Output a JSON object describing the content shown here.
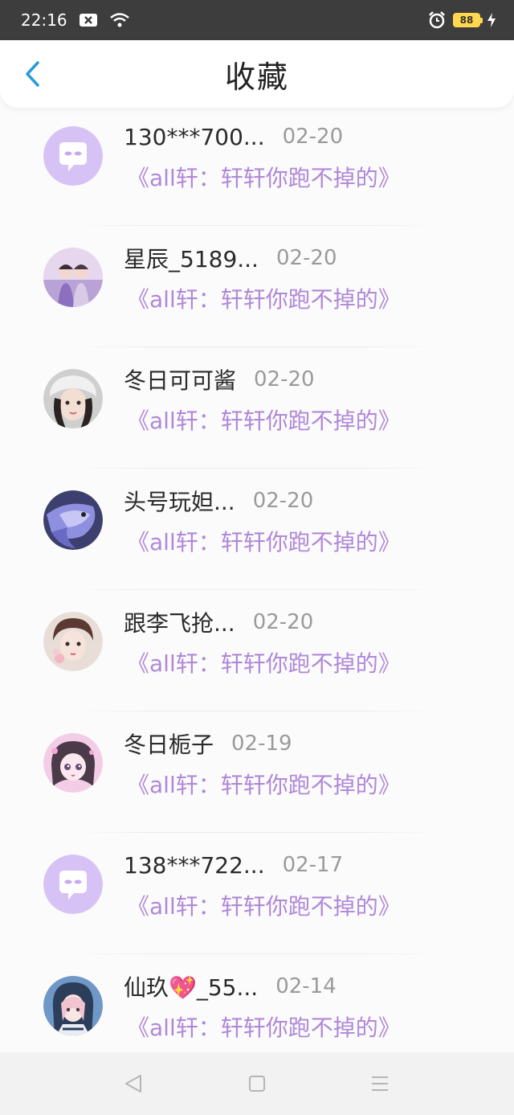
{
  "status_bar": {
    "time": "22:16",
    "battery": "88",
    "icons": [
      "notification-x-icon",
      "wifi-icon",
      "alarm-icon",
      "battery-icon",
      "charging-icon"
    ]
  },
  "header": {
    "title": "收藏",
    "back_icon": "chevron-left-icon",
    "accent_color": "#2a9bd8"
  },
  "story_color": "#b088d8",
  "items": [
    {
      "name": "130***700...",
      "date": "02-20",
      "story": "《all轩：轩轩你跑不掉的》",
      "avatar": "default-chat-avatar"
    },
    {
      "name": "星辰_5189...",
      "date": "02-20",
      "story": "《all轩：轩轩你跑不掉的》",
      "avatar": "photo-avatar"
    },
    {
      "name": "冬日可可酱",
      "date": "02-20",
      "story": "《all轩：轩轩你跑不掉的》",
      "avatar": "photo-avatar"
    },
    {
      "name": "头号玩妲...",
      "date": "02-20",
      "story": "《all轩：轩轩你跑不掉的》",
      "avatar": "photo-avatar"
    },
    {
      "name": "跟李飞抢...",
      "date": "02-20",
      "story": "《all轩：轩轩你跑不掉的》",
      "avatar": "photo-avatar"
    },
    {
      "name": "冬日栀子",
      "date": "02-19",
      "story": "《all轩：轩轩你跑不掉的》",
      "avatar": "photo-avatar"
    },
    {
      "name": "138***722...",
      "date": "02-17",
      "story": "《all轩：轩轩你跑不掉的》",
      "avatar": "default-chat-avatar"
    },
    {
      "name": "仙玖💖_55...",
      "date": "02-14",
      "story": "《all轩：轩轩你跑不掉的》",
      "avatar": "photo-avatar"
    }
  ],
  "nav_bar": {
    "icons": [
      "back-triangle-icon",
      "home-square-icon",
      "menu-lines-icon"
    ]
  }
}
